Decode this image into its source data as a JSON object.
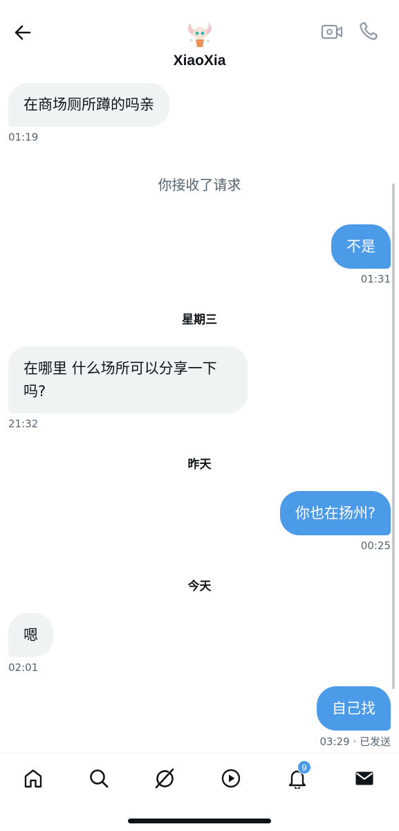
{
  "header": {
    "contact_name": "XiaoXia",
    "back_icon": "arrow-left-icon",
    "video_icon": "video-camera-icon",
    "call_icon": "phone-icon"
  },
  "messages": [
    {
      "text": "在商场厕所蹲的吗亲",
      "time": "01:19"
    },
    {
      "text": "你接收了请求"
    },
    {
      "text": "不是",
      "time": "01:31"
    },
    {
      "text": "星期三"
    },
    {
      "line1": "在哪里 什么场所可以分享一下",
      "line2": "吗?",
      "time": "21:32"
    },
    {
      "text": "昨天"
    },
    {
      "text": "你也在扬州?",
      "time": "00:25"
    },
    {
      "text": "今天"
    },
    {
      "text": "嗯",
      "time": "02:01"
    },
    {
      "text": "自己找",
      "time": "03:29 · 已发送"
    }
  ],
  "bottom_nav": {
    "items": [
      "home-icon",
      "search-icon",
      "grok-icon",
      "play-icon",
      "bell-icon",
      "mail-icon"
    ],
    "notification_count": "9"
  },
  "colors": {
    "accent": "#4c9be8",
    "incoming_bubble": "#eff3f4",
    "muted_text": "#536471"
  }
}
